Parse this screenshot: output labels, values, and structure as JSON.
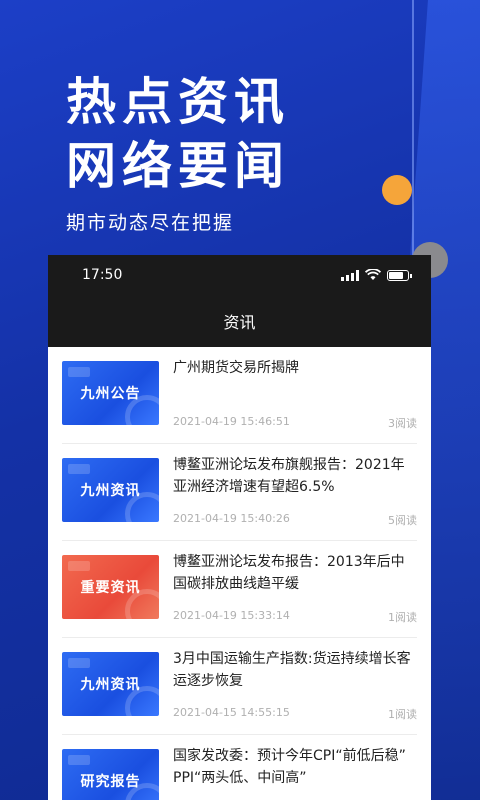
{
  "hero": {
    "title_line1": "热点资讯",
    "title_line2": "网络要闻",
    "subtitle": "期市动态尽在把握"
  },
  "status_bar": {
    "time": "17:50"
  },
  "nav": {
    "title": "资讯"
  },
  "news": [
    {
      "thumb_label": "九州公告",
      "thumb_color": "#2360e8",
      "title": "广州期货交易所揭牌",
      "date": "2021-04-19 15:46:51",
      "reads": "3阅读"
    },
    {
      "thumb_label": "九州资讯",
      "thumb_color": "#2360e8",
      "title": "博鳌亚洲论坛发布旗舰报告：2021年亚洲经济增速有望超6.5%",
      "date": "2021-04-19 15:40:26",
      "reads": "5阅读"
    },
    {
      "thumb_label": "重要资讯",
      "thumb_color": "#ee5a44",
      "title": "博鳌亚洲论坛发布报告：2013年后中国碳排放曲线趋平缓",
      "date": "2021-04-19 15:33:14",
      "reads": "1阅读"
    },
    {
      "thumb_label": "九州资讯",
      "thumb_color": "#2360e8",
      "title": "3月中国运输生产指数:货运持续增长客运逐步恢复",
      "date": "2021-04-15 14:55:15",
      "reads": "1阅读"
    },
    {
      "thumb_label": "研究报告",
      "thumb_color": "#2360e8",
      "title": "国家发改委：预计今年CPI“前低后稳” PPI“两头低、中间高”",
      "date": "",
      "reads": ""
    }
  ]
}
